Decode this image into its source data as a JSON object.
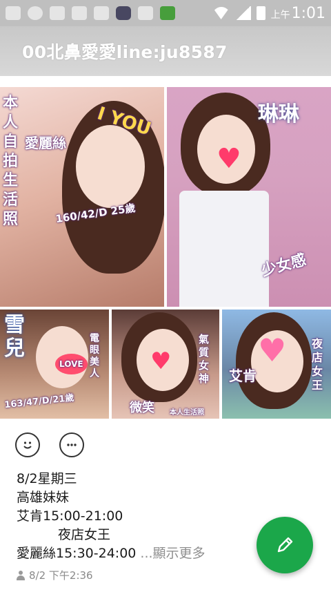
{
  "status_bar": {
    "time_prefix": "上午",
    "time": "1:01",
    "left_icons": [
      "add-icon",
      "wechat-icon",
      "shield-icon",
      "chat-icon",
      "image-icon",
      "app-icon",
      "refresh-icon",
      "upload-icon"
    ],
    "right_icons": [
      "wifi-icon",
      "signal-icon",
      "battery-icon"
    ]
  },
  "header": {
    "title": "00北鼻愛愛line:ju8587"
  },
  "photos": {
    "tile1": {
      "name": "愛麗絲",
      "side_text": "本人自拍生活照",
      "stats": "160/42/D 25歲",
      "badge": "I YOU"
    },
    "tile2": {
      "name": "琳琳",
      "tag": "少女感"
    },
    "tile3": {
      "name": "雪兒",
      "tag": "電眼美人",
      "badge": "LOVE",
      "stats": "163/47/D/21歲"
    },
    "tile4": {
      "name": "微笑",
      "tag": "氣質女神",
      "note": "本人生活照"
    },
    "tile5": {
      "name": "艾肯",
      "tag": "夜店女王"
    }
  },
  "actions": {
    "emoji_icon": "smiley-icon",
    "comment_icon": "comment-icon"
  },
  "post": {
    "line1": "8/2星期三",
    "line2": "高雄妹妹",
    "line3": "艾肯15:00-21:00",
    "line4": "夜店女王",
    "line5": "愛麗絲15:30-24:00",
    "more": "...顯示更多"
  },
  "meta": {
    "timestamp": "8/2 下午2:36"
  },
  "fab": {
    "icon": "pencil-icon",
    "color": "#1ba74a"
  }
}
